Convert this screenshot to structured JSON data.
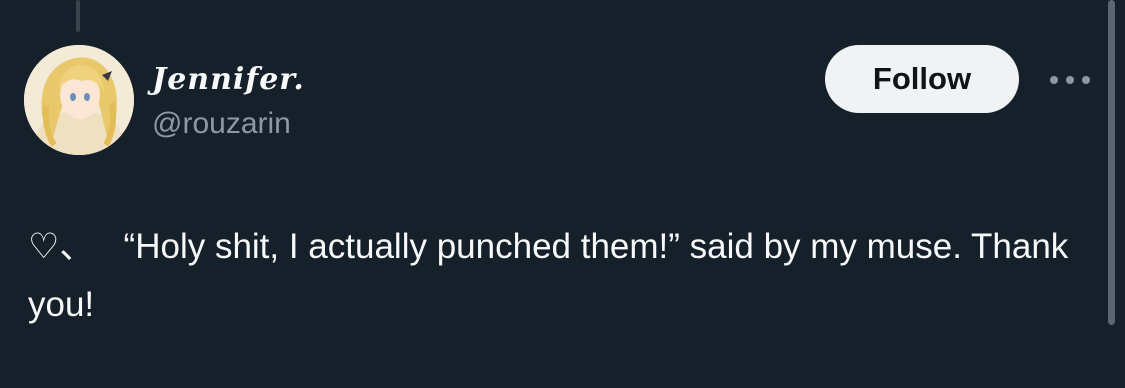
{
  "tweet": {
    "author": {
      "display_name": "Jennifer.",
      "handle": "@rouzarin",
      "avatar_icon": "anime-avatar"
    },
    "follow_label": "Follow",
    "more_icon": "more-horizontal-icon",
    "text": "♡、   “Holy shit, I actually punched them!” said by my muse. Thank you!"
  },
  "colors": {
    "background": "#15202b",
    "text_primary": "#f7f9f9",
    "text_secondary": "#8b98a5",
    "follow_bg": "#eff3f4"
  }
}
